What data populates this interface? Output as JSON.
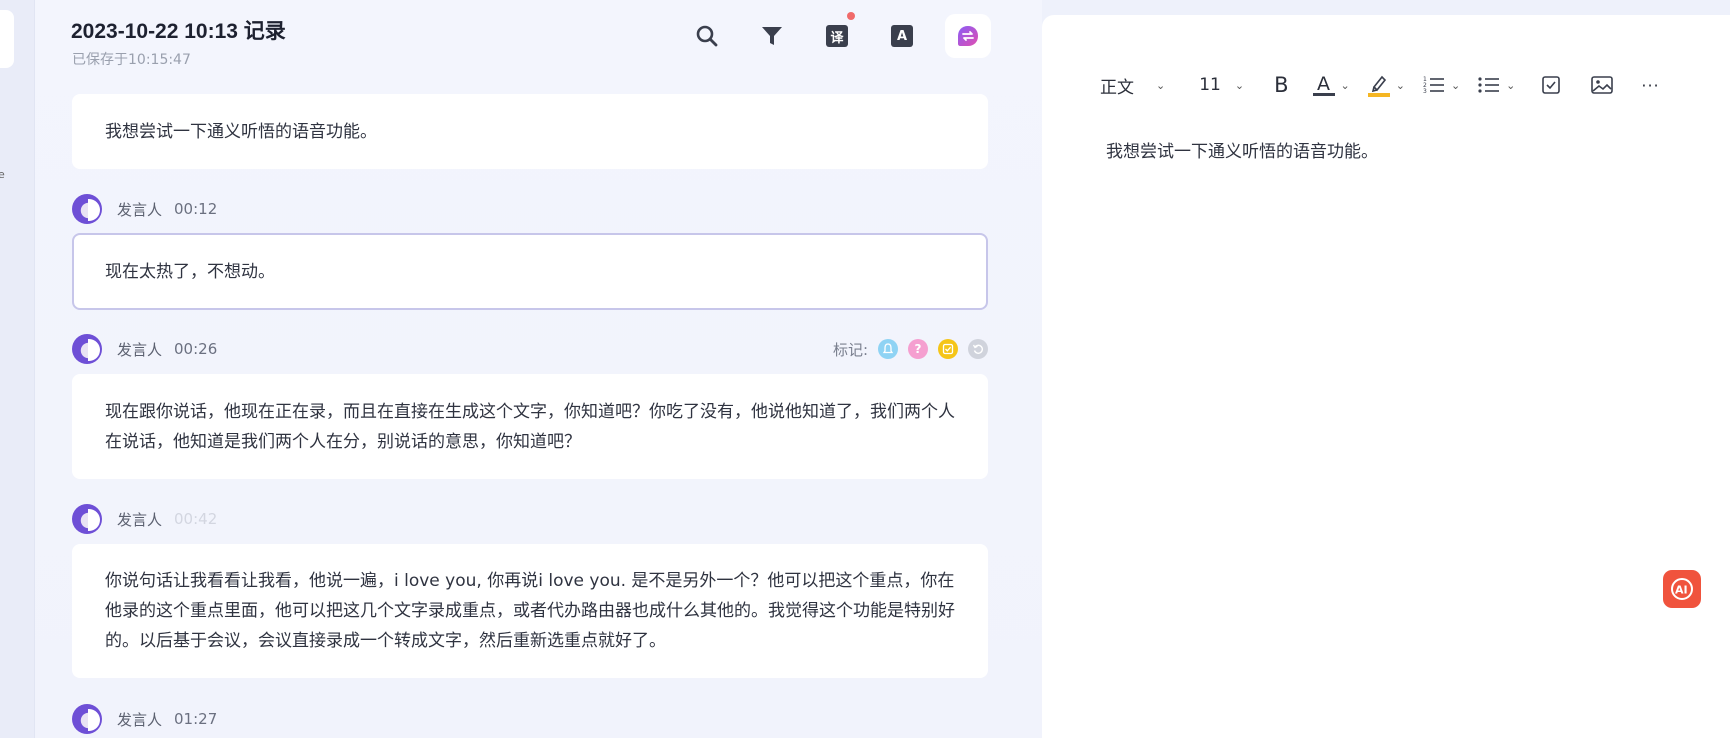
{
  "header": {
    "title": "2023-10-22 10:13 记录",
    "saved_status": "已保存于10:15:47"
  },
  "left_strip": {
    "cut_text": "e"
  },
  "toolbar": {
    "translate_glyph": "译",
    "dictionary_glyph": "A"
  },
  "transcript": {
    "first_text": "我想尝试一下通义听悟的语音功能。",
    "segments": [
      {
        "speaker": "发言人",
        "time": "00:12",
        "text": "现在太热了，不想动。"
      },
      {
        "speaker": "发言人",
        "time": "00:26",
        "text": "现在跟你说话，他现在正在录，而且在直接在生成这个文字，你知道吧？你吃了没有，他说他知道了，我们两个人在说话，他知道是我们两个人在分，别说话的意思，你知道吧？"
      },
      {
        "speaker": "发言人",
        "time": "00:42",
        "text": "你说句话让我看看让我看，他说一遍，i love you, 你再说i love you. 是不是另外一个？他可以把这个重点，你在他录的这个重点里面，他可以把这几个文字录成重点，或者代办路由器也成什么其他的。我觉得这个功能是特别好的。以后基于会议，会议直接录成一个转成文字，然后重新选重点就好了。"
      },
      {
        "speaker": "发言人",
        "time": "01:27"
      }
    ],
    "marks_label": "标记:"
  },
  "editor": {
    "style_select": "正文",
    "font_size": "11",
    "bold": "B",
    "text_color_glyph": "A",
    "more": "···",
    "body_text": "我想尝试一下通义听悟的语音功能。"
  },
  "colors": {
    "mark_blue": "#8fd3f4",
    "mark_pink": "#f59fd0",
    "mark_yellow": "#f5c518",
    "mark_gray": "#d0d3dc",
    "ai_fab": "#f0533d",
    "highlight_bar": "#f5b623"
  }
}
